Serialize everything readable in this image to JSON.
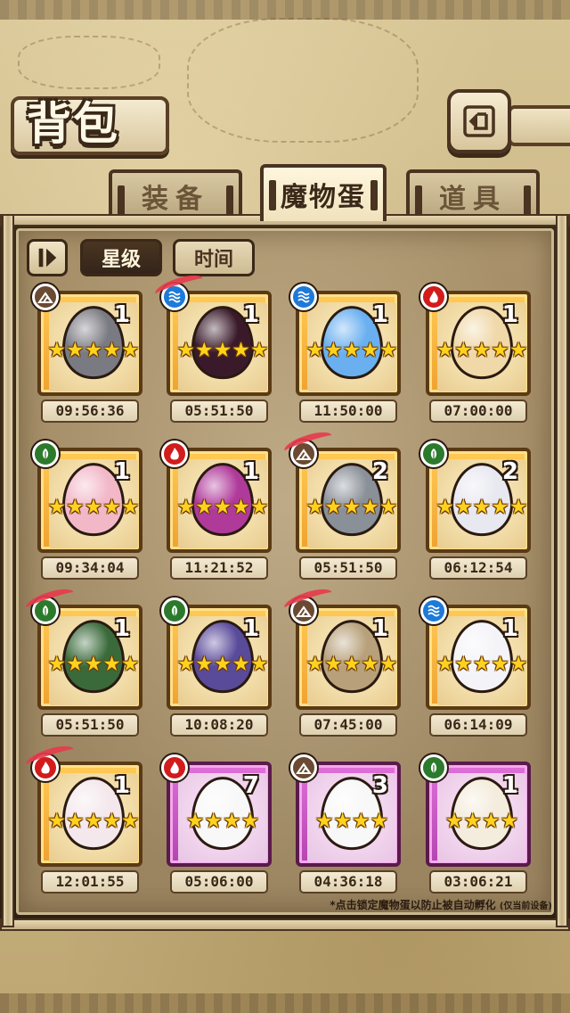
{
  "header": {
    "title": "背包",
    "back_icon": "back-arrow-icon"
  },
  "tabs": [
    {
      "label": "装备",
      "active": false
    },
    {
      "label": "魔物蛋",
      "active": true
    },
    {
      "label": "道具",
      "active": false
    }
  ],
  "sort": {
    "toggle_icon": "sort-toggle-icon",
    "star_label": "星级",
    "time_label": "时间",
    "active": "星级"
  },
  "eggs": [
    {
      "element": "earth",
      "count": "1",
      "stars": "★★★★★",
      "timer": "09:56:36",
      "frame": "gold",
      "egg_color": "#7a7a82",
      "marked": false
    },
    {
      "element": "water",
      "count": "1",
      "stars": "★★★★★",
      "timer": "05:51:50",
      "frame": "gold",
      "egg_color": "#3a1a2a",
      "marked": true
    },
    {
      "element": "water",
      "count": "1",
      "stars": "★★★★★",
      "timer": "11:50:00",
      "frame": "gold",
      "egg_color": "#6ab0f0",
      "marked": false
    },
    {
      "element": "fire",
      "count": "1",
      "stars": "★★★★★",
      "timer": "07:00:00",
      "frame": "gold",
      "egg_color": "#f0d8a8",
      "marked": false
    },
    {
      "element": "wood",
      "count": "1",
      "stars": "★★★★★",
      "timer": "09:34:04",
      "frame": "gold",
      "egg_color": "#f2b8c8",
      "marked": false
    },
    {
      "element": "fire",
      "count": "1",
      "stars": "★★★★★",
      "timer": "11:21:52",
      "frame": "gold",
      "egg_color": "#b03a9a",
      "marked": false
    },
    {
      "element": "earth",
      "count": "2",
      "stars": "★★★★★",
      "timer": "05:51:50",
      "frame": "gold",
      "egg_color": "#8a9098",
      "marked": true
    },
    {
      "element": "wood",
      "count": "2",
      "stars": "★★★★★",
      "timer": "06:12:54",
      "frame": "gold",
      "egg_color": "#e8e8f0",
      "marked": false
    },
    {
      "element": "wood",
      "count": "1",
      "stars": "★★★★★",
      "timer": "05:51:50",
      "frame": "gold",
      "egg_color": "#3a6a3a",
      "marked": true
    },
    {
      "element": "wood",
      "count": "1",
      "stars": "★★★★★",
      "timer": "10:08:20",
      "frame": "gold",
      "egg_color": "#5a4a9a",
      "marked": false
    },
    {
      "element": "earth",
      "count": "1",
      "stars": "★★★★★",
      "timer": "07:45:00",
      "frame": "gold",
      "egg_color": "#b8a07a",
      "marked": true
    },
    {
      "element": "water",
      "count": "1",
      "stars": "★★★★★",
      "timer": "06:14:09",
      "frame": "gold",
      "egg_color": "#f4f4f8",
      "marked": false
    },
    {
      "element": "fire",
      "count": "1",
      "stars": "★★★★★",
      "timer": "12:01:55",
      "frame": "gold",
      "egg_color": "#f4e8ec",
      "marked": true
    },
    {
      "element": "fire",
      "count": "7",
      "stars": "★★★★",
      "timer": "05:06:00",
      "frame": "purple",
      "egg_color": "#f8f8f8",
      "marked": false
    },
    {
      "element": "earth",
      "count": "3",
      "stars": "★★★★",
      "timer": "04:36:18",
      "frame": "purple",
      "egg_color": "#f8f8f8",
      "marked": false
    },
    {
      "element": "wood",
      "count": "1",
      "stars": "★★★★",
      "timer": "03:06:21",
      "frame": "purple",
      "egg_color": "#f4ecdc",
      "marked": false
    }
  ],
  "footnote": {
    "main": "*点击锁定魔物蛋以防止被自动孵化",
    "small": "(仅当前设备)"
  },
  "colors": {
    "earth": "#6a4a32",
    "water": "#1e7ad8",
    "fire": "#d21c1c",
    "wood": "#2c7a2c",
    "gold_frame": "#f0a230",
    "purple_frame": "#b444b0",
    "lock_mark": "#e83a4c"
  }
}
